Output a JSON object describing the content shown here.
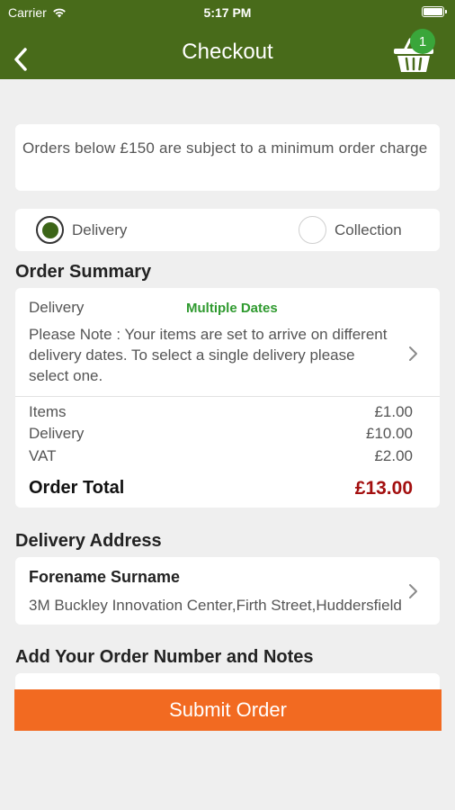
{
  "status_bar": {
    "carrier": "Carrier",
    "time": "5:17 PM"
  },
  "header": {
    "title": "Checkout",
    "cart_count": "1"
  },
  "notice": {
    "text": "Orders below £150 are subject to a minimum order charge"
  },
  "fulfilment": {
    "options": [
      {
        "label": "Delivery",
        "selected": true
      },
      {
        "label": "Collection",
        "selected": false
      }
    ]
  },
  "order_summary": {
    "title": "Order Summary",
    "delivery_label": "Delivery",
    "delivery_dates": "Multiple Dates",
    "note": "Please Note : Your items are set to arrive on different delivery dates. To select a single delivery please select one.",
    "rows": [
      {
        "label": "Items",
        "value": "£1.00"
      },
      {
        "label": "Delivery",
        "value": "£10.00"
      },
      {
        "label": "VAT",
        "value": "£2.00"
      }
    ],
    "total_label": "Order Total",
    "total_value": "£13.00"
  },
  "delivery_address": {
    "title": "Delivery Address",
    "name": "Forename Surname",
    "address": "3M Buckley Innovation Center,Firth Street,Huddersfield"
  },
  "notes_section": {
    "title": "Add Your Order Number and Notes"
  },
  "submit": {
    "label": "Submit Order"
  },
  "colors": {
    "header_bg": "#486b1a",
    "accent_orange": "#f26a21",
    "total_red": "#a30f0f",
    "badge_green": "#3aa63a",
    "dates_green": "#2f9a2f"
  }
}
